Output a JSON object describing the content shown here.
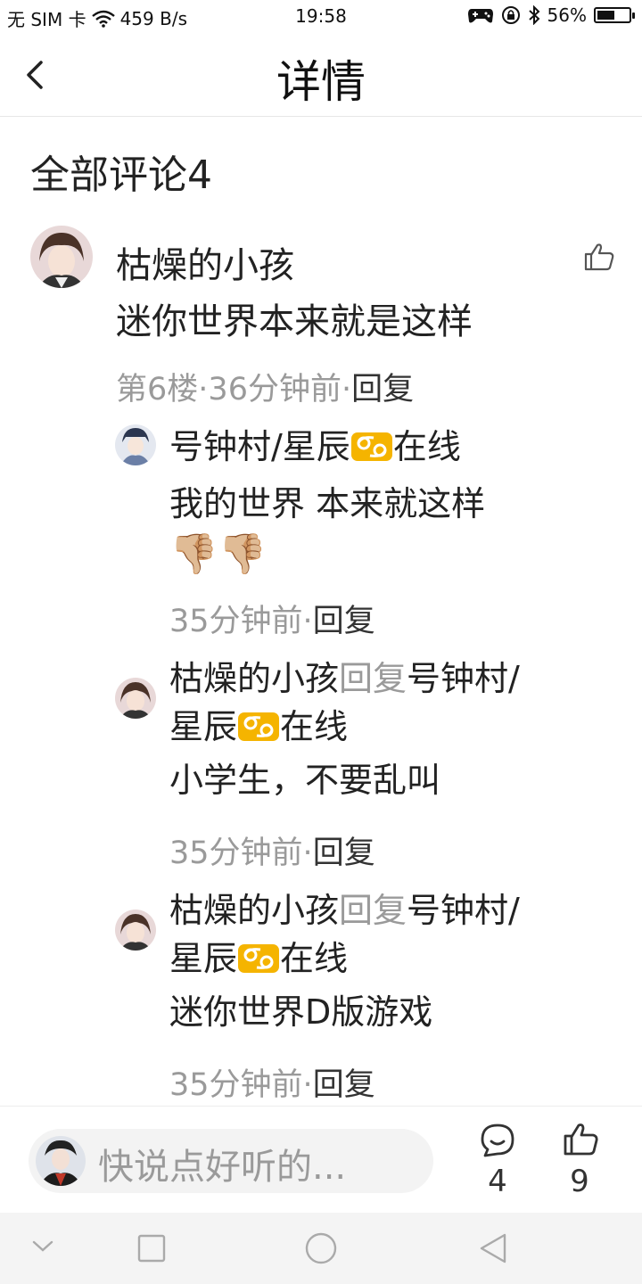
{
  "status_bar": {
    "carrier": "无 SIM 卡",
    "speed": "459 B/s",
    "time": "19:58",
    "battery": "56%",
    "battery_level": 0.56
  },
  "header": {
    "title": "详情"
  },
  "comments_section": {
    "title": "全部评论4"
  },
  "main_comment": {
    "author": "枯燥的小孩",
    "text": "迷你世界本来就是这样",
    "floor": "第6楼",
    "time": "36分钟前",
    "reply_label": "回复"
  },
  "replies": [
    {
      "author": "号钟村/星辰",
      "author_suffix": "在线",
      "text": "我的世界 本来就这样",
      "emoji": "👎🏼👎🏼",
      "time": "35分钟前",
      "reply_label": "回复"
    },
    {
      "author": "枯燥的小孩",
      "reply_word": "回复",
      "target": "号钟村/",
      "target_line2": "星辰",
      "target_suffix": "在线",
      "text": "小学生，不要乱叫",
      "time": "35分钟前",
      "reply_label": "回复"
    },
    {
      "author": "枯燥的小孩",
      "reply_word": "回复",
      "target": "号钟村/",
      "target_line2": "星辰",
      "target_suffix": "在线",
      "text": "迷你世界D版游戏",
      "time": "35分钟前",
      "reply_label": "回复"
    }
  ],
  "bottom_bar": {
    "input_placeholder": "快说点好听的...",
    "comment_count": "4",
    "like_count": "9"
  },
  "icons": {
    "zodiac": "cancer-zodiac-icon",
    "accent_zodiac_color": "#f5b400"
  }
}
